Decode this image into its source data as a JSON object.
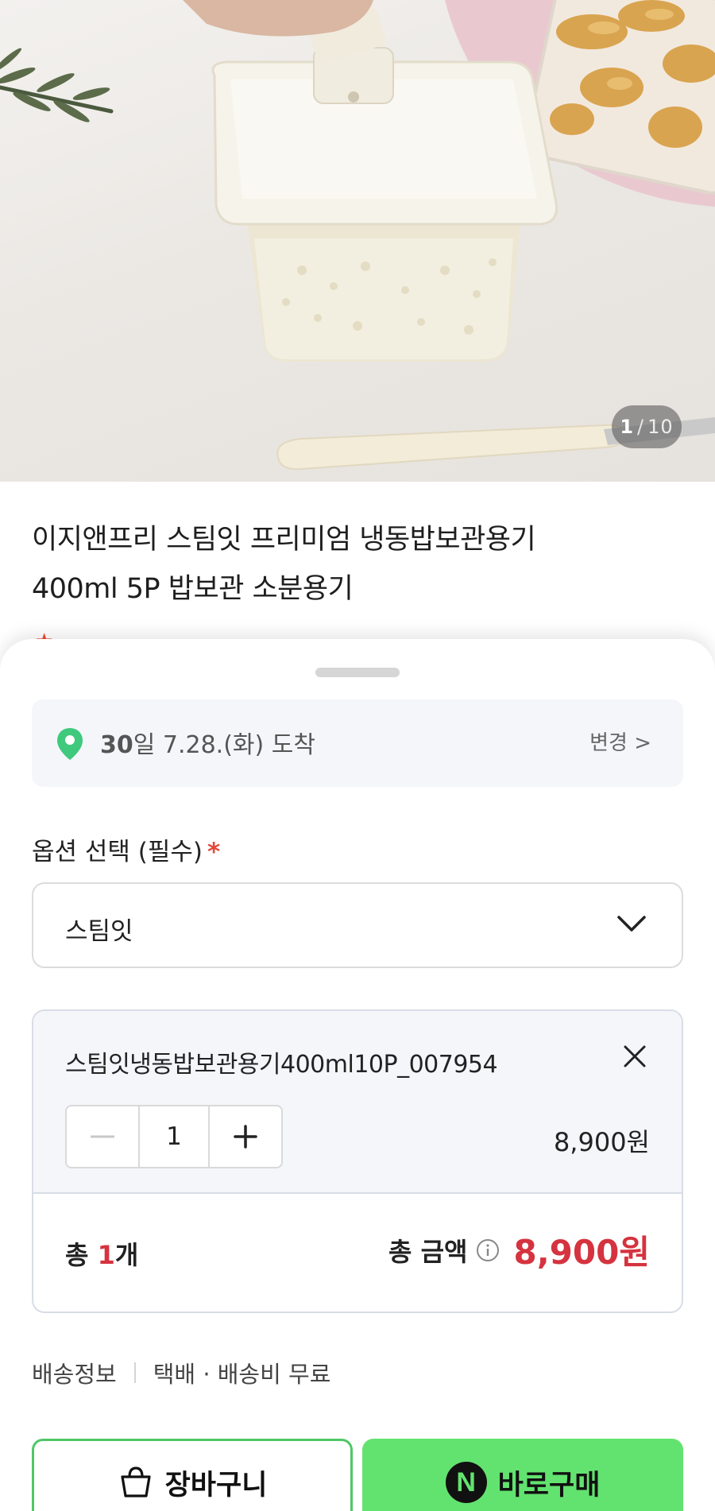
{
  "gallery": {
    "current": "1",
    "separator": "/",
    "total": "10"
  },
  "product": {
    "title_line1": "이지앤프리 스팀잇 프리미엄 냉동밥보관용기",
    "title_line2": "400ml 5P 밥보관 소분용기"
  },
  "sheet": {
    "delivery": {
      "icon": "location-pin-icon",
      "date_prefix": "30",
      "date_text": "일 7.28.(화) 도착",
      "change_label": "변경 >"
    },
    "option_label": "옵션 선택 (필수)",
    "required_mark": "*",
    "selected_option": "스팀잇",
    "item": {
      "name": "스팀잇냉동밥보관용기400ml10P_007954",
      "minus": "−",
      "quantity": "1",
      "plus": "+",
      "price": "8,900원"
    },
    "summary": {
      "count_prefix": "총 ",
      "count": "1",
      "count_suffix": "개",
      "total_label": "총 금액",
      "total_value": "8,900원"
    },
    "shipping": {
      "label": "배송정보",
      "value": "택배 · 배송비 무료"
    },
    "buttons": {
      "cart": "장바구니",
      "buy_logo": "N",
      "buy": "바로구매"
    }
  },
  "colors": {
    "accent_green": "#62e36f",
    "price_red": "#d5333f",
    "pin_green": "#3fc97c"
  }
}
